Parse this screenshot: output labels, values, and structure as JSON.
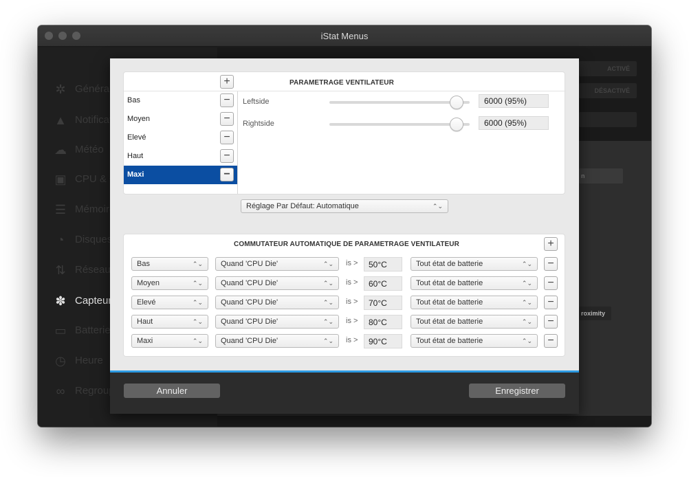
{
  "window": {
    "title": "iStat Menus"
  },
  "sidebar": {
    "items": [
      {
        "label": "Général",
        "icon": "gear-icon"
      },
      {
        "label": "Notifications",
        "icon": "bell-icon"
      },
      {
        "label": "Météo",
        "icon": "weather-icon"
      },
      {
        "label": "CPU & GPU",
        "icon": "cpu-icon"
      },
      {
        "label": "Mémoire",
        "icon": "memory-icon"
      },
      {
        "label": "Disques",
        "icon": "disk-icon"
      },
      {
        "label": "Réseau",
        "icon": "network-icon"
      },
      {
        "label": "Capteurs",
        "icon": "fan-icon"
      },
      {
        "label": "Batterie",
        "icon": "battery-icon"
      },
      {
        "label": "Heure",
        "icon": "clock-icon"
      },
      {
        "label": "Regroupé",
        "icon": "combined-icon"
      }
    ]
  },
  "background": {
    "btn_active": "ACTIVÉ",
    "btn_inactive": "DÉSACTIVÉ",
    "btn_partial1": "n",
    "btn_partial2": "roximity"
  },
  "fan_settings": {
    "title": "PARAMETRAGE VENTILATEUR",
    "add_label": "+",
    "levels": [
      {
        "label": "Bas",
        "selected": false
      },
      {
        "label": "Moyen",
        "selected": false
      },
      {
        "label": "Elevé",
        "selected": false
      },
      {
        "label": "Haut",
        "selected": false
      },
      {
        "label": "Maxi",
        "selected": true
      }
    ],
    "fans": [
      {
        "name": "Leftside",
        "value": "6000 (95%)",
        "level": 0.95
      },
      {
        "name": "Rightside",
        "value": "6000 (95%)",
        "level": 0.95
      }
    ]
  },
  "default_setting": {
    "value": "Réglage Par Défaut: Automatique"
  },
  "auto_switch": {
    "title": "COMMUTATEUR AUTOMATIQUE DE PARAMETRAGE VENTILATEUR",
    "add_label": "+",
    "is_label": "is >",
    "rules": [
      {
        "level": "Bas",
        "condition": "Quand 'CPU Die'",
        "temp": "50°C",
        "battery": "Tout état de batterie"
      },
      {
        "level": "Moyen",
        "condition": "Quand 'CPU Die'",
        "temp": "60°C",
        "battery": "Tout état de batterie"
      },
      {
        "level": "Elevé",
        "condition": "Quand 'CPU Die'",
        "temp": "70°C",
        "battery": "Tout état de batterie"
      },
      {
        "level": "Haut",
        "condition": "Quand 'CPU Die'",
        "temp": "80°C",
        "battery": "Tout état de batterie"
      },
      {
        "level": "Maxi",
        "condition": "Quand 'CPU Die'",
        "temp": "90°C",
        "battery": "Tout état de batterie"
      }
    ]
  },
  "footer": {
    "cancel_label": "Annuler",
    "save_label": "Enregistrer"
  },
  "colors": {
    "selection": "#0b4ea2",
    "accent_line": "#2d9ae2"
  }
}
